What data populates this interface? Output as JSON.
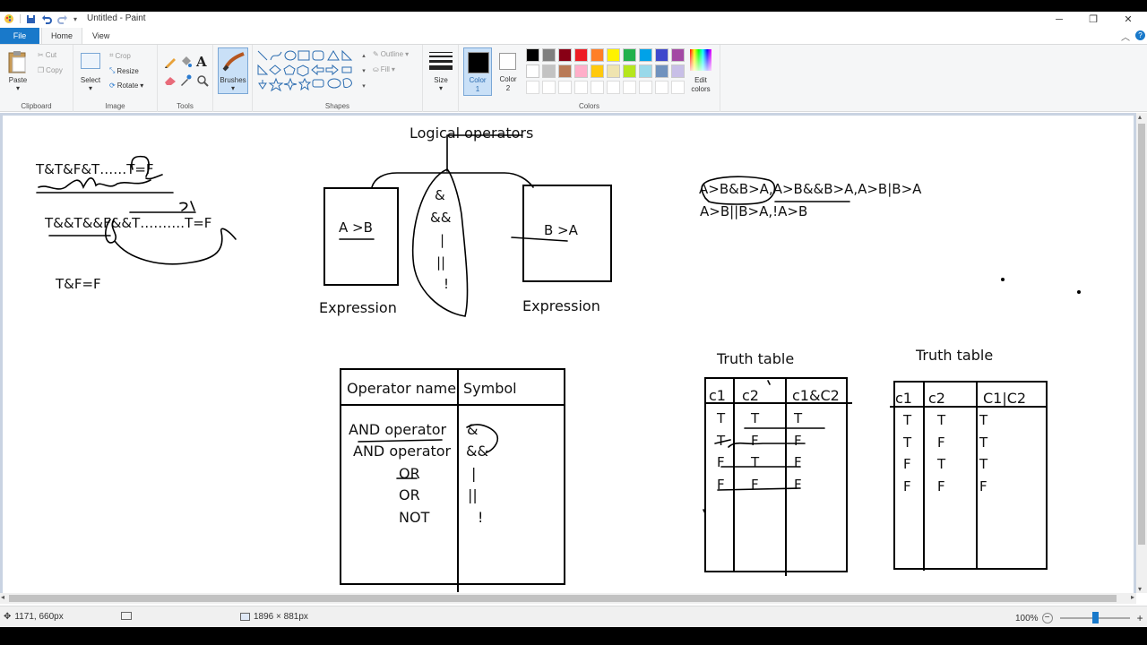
{
  "window": {
    "title": "Untitled - Paint",
    "minimize": "─",
    "maximize": "❐",
    "close": "✕"
  },
  "tabs": {
    "file": "File",
    "home": "Home",
    "view": "View"
  },
  "ribbon": {
    "clipboard": {
      "label": "Clipboard",
      "paste": "Paste",
      "cut": "Cut",
      "copy": "Copy"
    },
    "image": {
      "label": "Image",
      "select": "Select",
      "crop": "Crop",
      "resize": "Resize",
      "rotate": "Rotate"
    },
    "tools": {
      "label": "Tools"
    },
    "brushes": {
      "label": "Brushes"
    },
    "shapes": {
      "label": "Shapes",
      "outline": "Outline",
      "fill": "Fill"
    },
    "size": {
      "label": "Size"
    },
    "colors": {
      "label": "Colors",
      "color1": "Color\n1",
      "color1_a": "Color",
      "color1_b": "1",
      "color2_a": "Color",
      "color2_b": "2",
      "edit_a": "Edit",
      "edit_b": "colors",
      "row1": [
        "#000000",
        "#7f7f7f",
        "#880015",
        "#ed1c24",
        "#ff7f27",
        "#fff200",
        "#22b14c",
        "#00a2e8",
        "#3f48cc",
        "#a349a4"
      ],
      "row2": [
        "#ffffff",
        "#c3c3c3",
        "#b97a57",
        "#ffaec9",
        "#ffc90e",
        "#efe4b0",
        "#b5e61d",
        "#99d9ea",
        "#7092be",
        "#c8bfe7"
      ],
      "row3": [
        "#ffffff",
        "#ffffff",
        "#ffffff",
        "#ffffff",
        "#ffffff",
        "#ffffff",
        "#ffffff",
        "#ffffff",
        "#ffffff",
        "#ffffff"
      ]
    }
  },
  "canvas": {
    "left_notes": {
      "line1": "T&T&F&T……T=F",
      "line2": "T&&T&&F&&T……….T=F",
      "line3": "T&F=F"
    },
    "diagram": {
      "title": "Logical operators",
      "left_box": "A >B",
      "right_box": "B >A",
      "left_caption": "Expression",
      "right_caption": "Expression",
      "ops": [
        "&",
        "&&",
        "|",
        "||",
        "!"
      ]
    },
    "right_notes": {
      "line1": "A>B&B>A,A>B&&B>A,A>B|B>A",
      "line2": "A>B||B>A,!A>B"
    },
    "op_table": {
      "headers": [
        "Operator name",
        "Symbol"
      ],
      "rows": [
        {
          "name": "AND operator",
          "symbol": "&"
        },
        {
          "name": "AND operator",
          "symbol": "&&"
        },
        {
          "name": "OR",
          "symbol": "|"
        },
        {
          "name": "OR",
          "symbol": "||"
        },
        {
          "name": "NOT",
          "symbol": "!"
        }
      ]
    },
    "truth_and": {
      "title": "Truth table",
      "headers": [
        "c1",
        "c2",
        "c1&C2"
      ],
      "rows": [
        [
          "T",
          "T",
          "T"
        ],
        [
          "T",
          "F",
          "F"
        ],
        [
          "F",
          "T",
          "F"
        ],
        [
          "F",
          "F",
          "F"
        ]
      ]
    },
    "truth_or": {
      "title": "Truth table",
      "headers": [
        "c1",
        "c2",
        "C1|C2"
      ],
      "rows": [
        [
          "T",
          "T",
          "T"
        ],
        [
          "T",
          "F",
          "T"
        ],
        [
          "F",
          "T",
          "T"
        ],
        [
          "F",
          "F",
          "F"
        ]
      ]
    }
  },
  "status": {
    "cursor": "1171, 660px",
    "size": "1896 × 881px",
    "zoom": "100%"
  }
}
